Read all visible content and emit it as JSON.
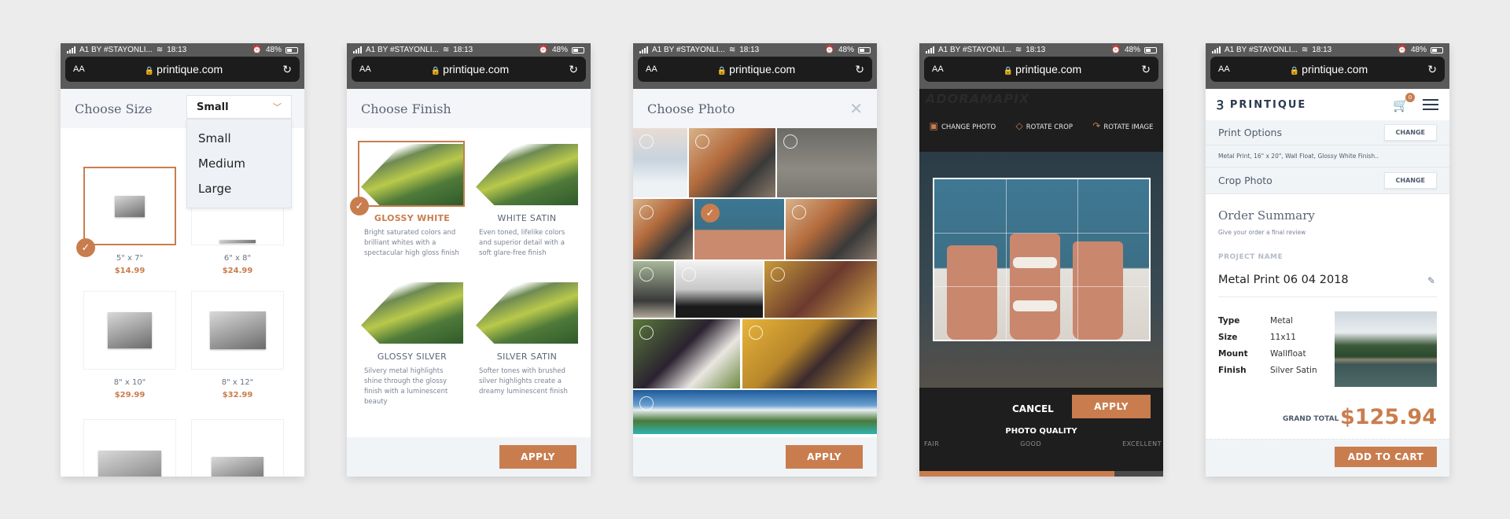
{
  "status_bar": {
    "carrier": "A1 BY #STAYONLI...",
    "time": "18:13",
    "battery": "48%"
  },
  "browser": {
    "text_size": "AA",
    "url": "printique.com"
  },
  "screen_size": {
    "title": "Choose Size",
    "dropdown_value": "Small",
    "dropdown_options": [
      "Small",
      "Medium",
      "Large"
    ],
    "sizes": [
      {
        "label": "5\" x 7\"",
        "price": "$14.99",
        "selected": true
      },
      {
        "label": "6\" x 8\"",
        "price": "$24.99",
        "selected": false
      },
      {
        "label": "8\" x 10\"",
        "price": "$29.99",
        "selected": false
      },
      {
        "label": "8\" x 12\"",
        "price": "$32.99",
        "selected": false
      }
    ]
  },
  "screen_finish": {
    "title": "Choose Finish",
    "finishes": [
      {
        "name": "GLOSSY WHITE",
        "desc": "Bright saturated colors and brilliant whites with a spectacular high gloss finish",
        "selected": true
      },
      {
        "name": "WHITE SATIN",
        "desc": "Even toned, lifelike colors and superior detail with a soft glare-free finish",
        "selected": false
      },
      {
        "name": "GLOSSY SILVER",
        "desc": "Silvery metal highlights shine through the glossy finish with a luminescent beauty",
        "selected": false
      },
      {
        "name": "SILVER SATIN",
        "desc": "Softer tones with brushed silver highlights create a dreamy luminescent finish",
        "selected": false
      }
    ],
    "apply_label": "APPLY"
  },
  "screen_photo": {
    "title": "Choose Photo",
    "photos": [
      "mountain-hiker",
      "couple-kiss-husky",
      "couple-legs",
      "couple-kiss-husky-2",
      "smoothies",
      "couple-kiss-husky-3",
      "couple-dog-fence",
      "husky-bw",
      "family-autumn",
      "family-baby",
      "family-autumn-2",
      "island-panorama"
    ],
    "selected_photo": "smoothies",
    "apply_label": "APPLY"
  },
  "screen_crop": {
    "logo": "ADORAMAPIX",
    "tools": [
      {
        "icon": "image-icon",
        "label": "CHANGE PHOTO"
      },
      {
        "icon": "rotate-crop-icon",
        "label": "ROTATE CROP"
      },
      {
        "icon": "rotate-image-icon",
        "label": "ROTATE IMAGE"
      }
    ],
    "cancel_label": "CANCEL",
    "apply_label": "APPLY",
    "quality_title": "PHOTO QUALITY",
    "quality_labels": [
      "FAIR",
      "GOOD",
      "EXCELLENT"
    ],
    "quality_percent": 80
  },
  "screen_summary": {
    "brand": "PRINTIQUE",
    "cart_count": "0",
    "print_options_label": "Print Options",
    "change_label": "CHANGE",
    "print_options_value": "Metal Print, 16\" x 20\", Wall Float, Glossy White Finish..",
    "crop_photo_label": "Crop Photo",
    "title": "Order Summary",
    "subtitle": "Give your order a final review",
    "project_name_label": "PROJECT NAME",
    "project_name": "Metal Print 06 04 2018",
    "specs": [
      {
        "k": "Type",
        "v": "Metal"
      },
      {
        "k": "Size",
        "v": "11x11"
      },
      {
        "k": "Mount",
        "v": "Wallfloat"
      },
      {
        "k": "Finish",
        "v": "Silver Satin"
      }
    ],
    "grand_total_label": "GRAND TOTAL",
    "grand_total": "$125.94",
    "add_to_cart_label": "ADD TO CART"
  },
  "colors": {
    "accent": "#c97d4e",
    "header_bg": "#f3f5f8",
    "dark_bg": "#1e1e1e"
  }
}
